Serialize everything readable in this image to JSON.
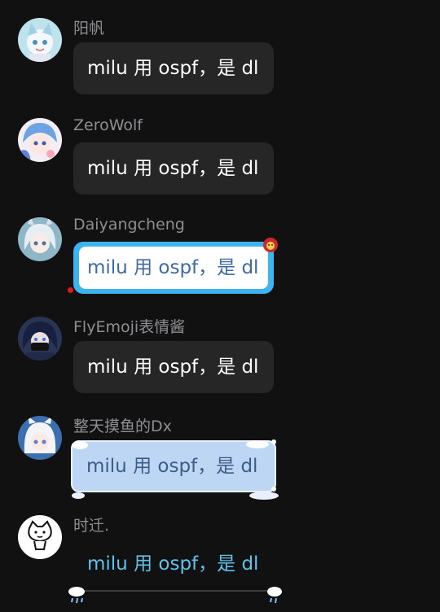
{
  "messages": [
    {
      "sender": "阳帆",
      "text": "milu 用 ospf，是 dl",
      "style": "default"
    },
    {
      "sender": "ZeroWolf",
      "text": "milu 用 ospf，是 dl",
      "style": "default"
    },
    {
      "sender": "Daiyangcheng",
      "text": "milu 用 ospf，是 dl",
      "style": "blue-frame"
    },
    {
      "sender": "FlyEmoji表情酱",
      "text": "milu 用 ospf，是 dl",
      "style": "default"
    },
    {
      "sender": "整天摸鱼的Dx",
      "text": "milu 用 ospf，是 dl",
      "style": "frosted"
    },
    {
      "sender": "时迁.",
      "text": "milu 用 ospf，是 dl",
      "style": "plain-cloud"
    }
  ],
  "colors": {
    "background": "#111112",
    "bubble_default": "#262627",
    "name_text": "#8e8e93",
    "blue_frame": "#3bb4f0",
    "frosted_bubble": "#bcd6f3",
    "plain_text": "#5fc3ea"
  },
  "icons": [
    "avatar-anime-cat",
    "avatar-blue-hair",
    "avatar-silver-hair",
    "avatar-masked",
    "avatar-white-hood",
    "avatar-cartoon-cat",
    "badge-emoji-icon",
    "cloud-rain-icon",
    "snow-frame-deco"
  ]
}
